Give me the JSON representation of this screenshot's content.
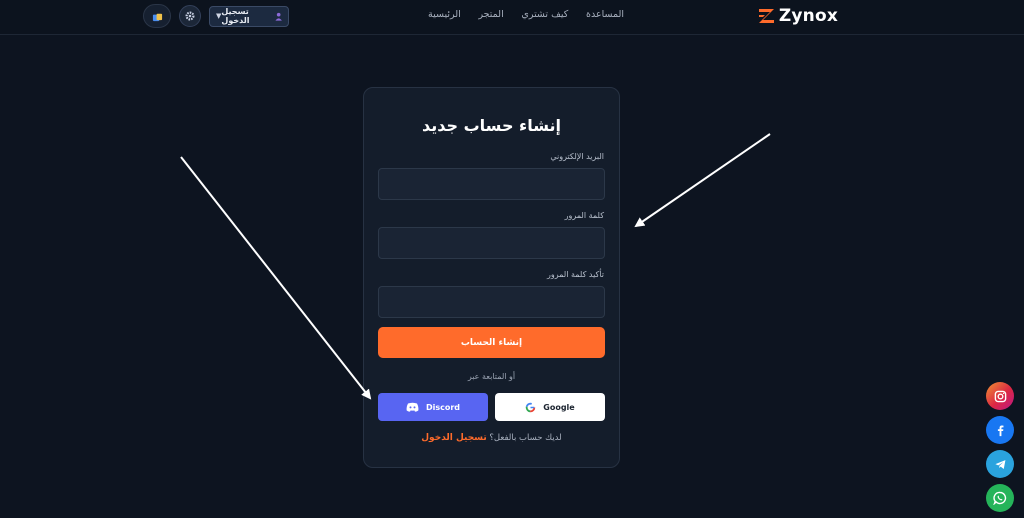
{
  "header": {
    "logo_text": "Zynox",
    "nav": [
      "الرئيسية",
      "المتجر",
      "كيف تشتري",
      "المساعدة"
    ],
    "login_label": "تسجيل الدخول",
    "dropdown_caret": "▼"
  },
  "form": {
    "title": "إنشاء حساب جديد",
    "email_label": "البريد الإلكتروني",
    "password_label": "كلمة المرور",
    "confirm_label": "تأكيد كلمة المرور",
    "email_value": "",
    "password_value": "",
    "confirm_value": "",
    "submit_label": "إنشاء الحساب",
    "or_text": "أو المتابعة عبر",
    "google_label": "Google",
    "discord_label": "Discord",
    "have_account_text": "لديك حساب بالفعل؟",
    "signin_link": "تسجيل الدخول"
  },
  "colors": {
    "accent": "#ff6b2b",
    "discord": "#5865f2",
    "background": "#0d1420",
    "card": "#141d2b"
  },
  "icons": {
    "gear": "gear-icon",
    "cart": "shopping-bag-icon",
    "user": "user-icon",
    "google": "google-icon",
    "discord": "discord-icon",
    "instagram": "instagram-icon",
    "facebook": "facebook-icon",
    "telegram": "telegram-icon",
    "whatsapp": "whatsapp-icon"
  }
}
